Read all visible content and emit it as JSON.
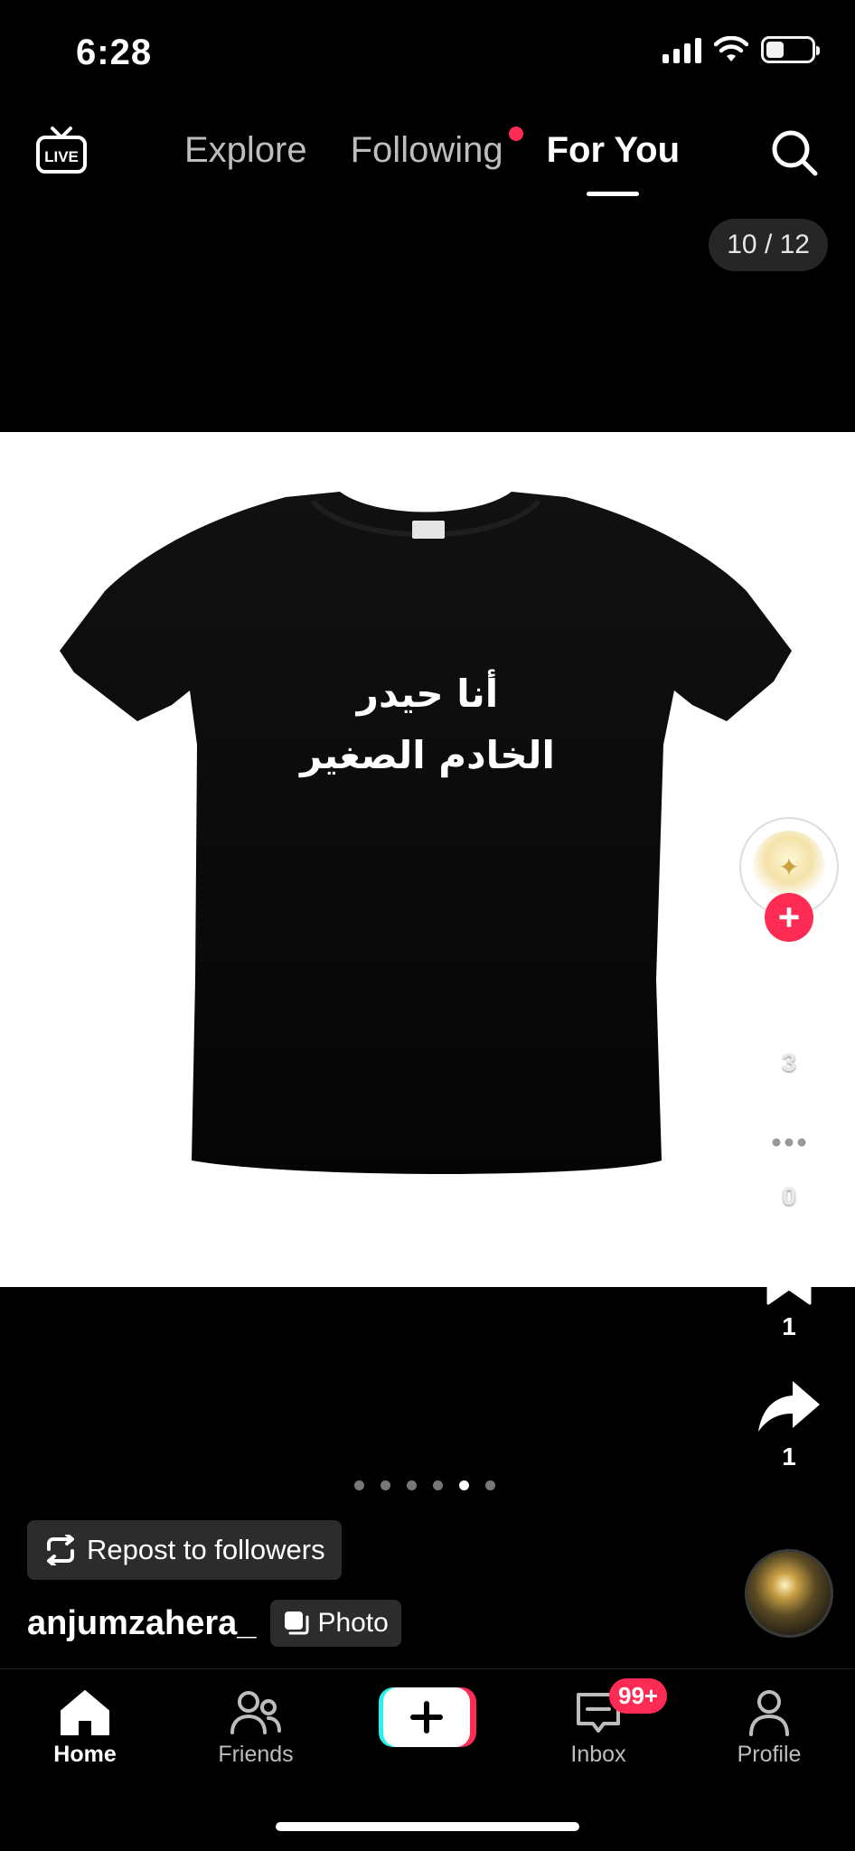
{
  "status_bar": {
    "time": "6:28",
    "battery_level": 0.4
  },
  "top_nav": {
    "live_label": "LIVE",
    "tabs": [
      {
        "label": "Explore",
        "active": false,
        "has_dot": false
      },
      {
        "label": "Following",
        "active": false,
        "has_dot": true
      },
      {
        "label": "For You",
        "active": true,
        "has_dot": false
      }
    ],
    "search_icon": "search-icon"
  },
  "post": {
    "page_counter": "10 / 12",
    "shirt_text_line1": "أنا حيدر",
    "shirt_text_line2": "الخادم الصغير",
    "carousel": {
      "total": 6,
      "current_index": 4
    },
    "likes": "3",
    "comments": "0",
    "bookmarks": "1",
    "shares": "1",
    "repost_label": "Repost to followers",
    "username": "anjumzahera_",
    "type_badge": "Photo"
  },
  "tab_bar": {
    "home": "Home",
    "friends": "Friends",
    "inbox": "Inbox",
    "inbox_badge": "99+",
    "profile": "Profile"
  },
  "colors": {
    "accent": "#fe2c55",
    "create_left": "#25f4ee",
    "create_right": "#fe2c55"
  }
}
